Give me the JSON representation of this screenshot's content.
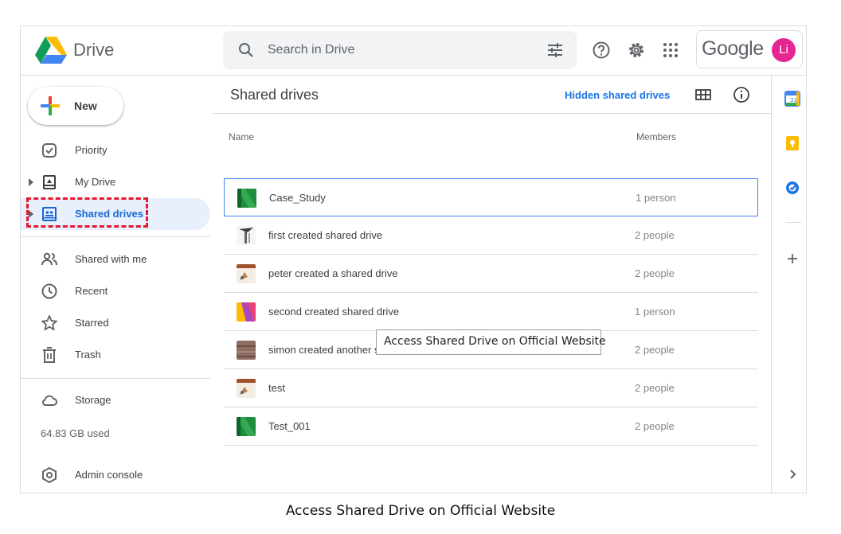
{
  "header": {
    "app_name": "Drive",
    "search_placeholder": "Search in Drive",
    "brand_word": "Google",
    "avatar_initials": "Li",
    "avatar_color": "#e52592"
  },
  "sidebar": {
    "new_label": "New",
    "items": [
      {
        "label": "Priority",
        "icon": "priority-check-icon"
      },
      {
        "label": "My Drive",
        "icon": "my-drive-icon"
      },
      {
        "label": "Shared drives",
        "icon": "shared-drives-icon",
        "active": true
      },
      {
        "label": "Shared with me",
        "icon": "people-icon"
      },
      {
        "label": "Recent",
        "icon": "clock-icon"
      },
      {
        "label": "Starred",
        "icon": "star-icon"
      },
      {
        "label": "Trash",
        "icon": "trash-icon"
      },
      {
        "label": "Storage",
        "icon": "cloud-icon"
      },
      {
        "label": "Admin console",
        "icon": "admin-shield-icon"
      }
    ],
    "storage_used": "64.83 GB used"
  },
  "main": {
    "title": "Shared drives",
    "hidden_link": "Hidden shared drives",
    "columns": {
      "name": "Name",
      "members": "Members"
    },
    "rows": [
      {
        "name": "Case_Study",
        "members": "1 person",
        "theme": "green"
      },
      {
        "name": "first created shared drive",
        "members": "2 people",
        "theme": "sketch"
      },
      {
        "name": "peter created a shared drive",
        "members": "2 people",
        "theme": "desk"
      },
      {
        "name": "second created shared drive",
        "members": "1 person",
        "theme": "colorful"
      },
      {
        "name": "simon created another shared drive",
        "members": "2 people",
        "theme": "wood"
      },
      {
        "name": "test",
        "members": "2 people",
        "theme": "desk"
      },
      {
        "name": "Test_001",
        "members": "2 people",
        "theme": "green"
      }
    ]
  },
  "tooltip": "Access Shared Drive on Official Website",
  "caption": "Access Shared Drive on Official Website",
  "colors": {
    "accent": "#1a73e8",
    "active_bg": "#e8f0fe",
    "highlight": "#e8162e"
  }
}
